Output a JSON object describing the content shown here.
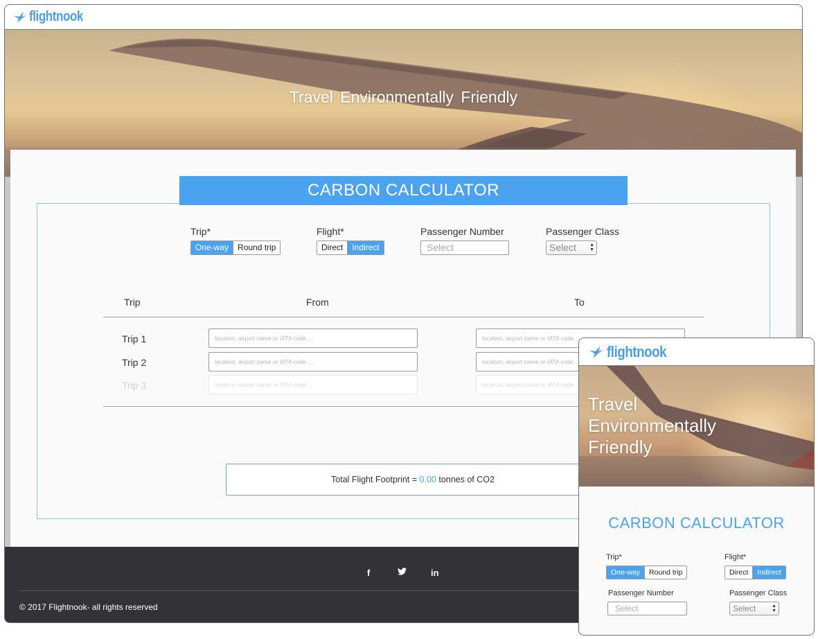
{
  "brand": {
    "name": "flightnook",
    "logo_icon": "bird-icon",
    "color": "#4a9fe3"
  },
  "hero": {
    "title": "Travel Environmentally Friendly"
  },
  "calculator": {
    "title": "CARBON CALCULATOR",
    "accent": "#4ba3f0",
    "trip": {
      "label": "Trip*",
      "options": [
        "One-way",
        "Round trip"
      ],
      "selected": "One-way"
    },
    "flight": {
      "label": "Flight*",
      "options": [
        "Direct",
        "Indirect"
      ],
      "selected": "Indirect"
    },
    "passenger_number": {
      "label": "Passenger Number",
      "placeholder": "Select"
    },
    "passenger_class": {
      "label": "Passenger Class",
      "value": "Select"
    },
    "table": {
      "headers": [
        "Trip",
        "From",
        "To"
      ],
      "rows": [
        {
          "label": "Trip 1",
          "from_placeholder": "location, airport name or IATA code ...",
          "to_placeholder": "location, airport name or IATA code ..."
        },
        {
          "label": "Trip 2",
          "from_placeholder": "location, airport name or IATA code ...",
          "to_placeholder": "location, airport name or IATA code ..."
        },
        {
          "label": "Trip 3",
          "from_placeholder": "location, airport name or IATA code ...",
          "to_placeholder": "location, airport name or IATA code ..."
        }
      ]
    },
    "total": {
      "prefix": "Total Flight Footprint = ",
      "value": "0.00",
      "suffix": " tonnes of CO2"
    }
  },
  "footer": {
    "social": [
      {
        "icon": "facebook-icon",
        "glyph": "f"
      },
      {
        "icon": "twitter-icon",
        "glyph": "🐦"
      },
      {
        "icon": "linkedin-icon",
        "glyph": "in"
      }
    ],
    "copyright": "© 2017 Flightnook- all rights reserved"
  },
  "mobile": {
    "hero_title": "Travel Environmentally Friendly",
    "calc_title": "CARBON CALCULATOR",
    "trip_label": "Trip*",
    "trip_options": [
      "One-way",
      "Round trip"
    ],
    "flight_label": "Flight*",
    "flight_options": [
      "Direct",
      "Indirect"
    ],
    "passenger_number_label": "Passenger Number",
    "passenger_number_placeholder": "Select",
    "passenger_class_label": "Passenger Class",
    "passenger_class_value": "Select"
  }
}
